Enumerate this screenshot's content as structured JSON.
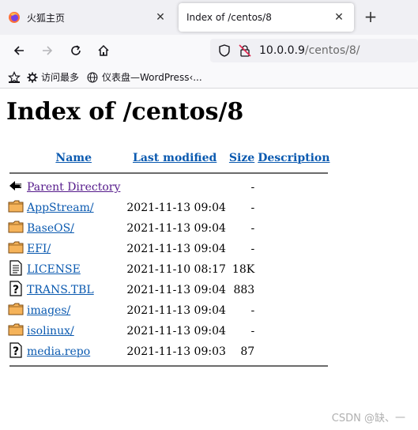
{
  "browser": {
    "tabs": [
      {
        "title": "火狐主页",
        "icon": "firefox-icon",
        "active": false
      },
      {
        "title": "Index of /centos/8",
        "active": true
      }
    ],
    "url_host": "10.0.0.9",
    "url_path": "/centos/8/",
    "bookmarks": [
      {
        "label": "访问最多",
        "icon": "gear-icon"
      },
      {
        "label": "仪表盘—WordPress‹...",
        "icon": "globe-icon"
      }
    ]
  },
  "page": {
    "heading": "Index of /centos/8",
    "columns": {
      "name": "Name",
      "modified": "Last modified",
      "size": "Size",
      "description": "Description"
    },
    "parent": {
      "label": "Parent Directory",
      "size": "-"
    },
    "rows": [
      {
        "name": "AppStream/",
        "modified": "2021-11-13 09:04",
        "size": "-",
        "icon": "folder-icon"
      },
      {
        "name": "BaseOS/",
        "modified": "2021-11-13 09:04",
        "size": "-",
        "icon": "folder-icon"
      },
      {
        "name": "EFI/",
        "modified": "2021-11-13 09:04",
        "size": "-",
        "icon": "folder-icon"
      },
      {
        "name": "LICENSE",
        "modified": "2021-11-10 08:17",
        "size": "18K",
        "icon": "text-file-icon"
      },
      {
        "name": "TRANS.TBL",
        "modified": "2021-11-13 09:04",
        "size": "883",
        "icon": "unknown-file-icon"
      },
      {
        "name": "images/",
        "modified": "2021-11-13 09:04",
        "size": "-",
        "icon": "folder-icon"
      },
      {
        "name": "isolinux/",
        "modified": "2021-11-13 09:04",
        "size": "-",
        "icon": "folder-icon"
      },
      {
        "name": "media.repo",
        "modified": "2021-11-13 09:03",
        "size": "87",
        "icon": "unknown-file-icon"
      }
    ]
  },
  "watermark": "CSDN @缺、一"
}
